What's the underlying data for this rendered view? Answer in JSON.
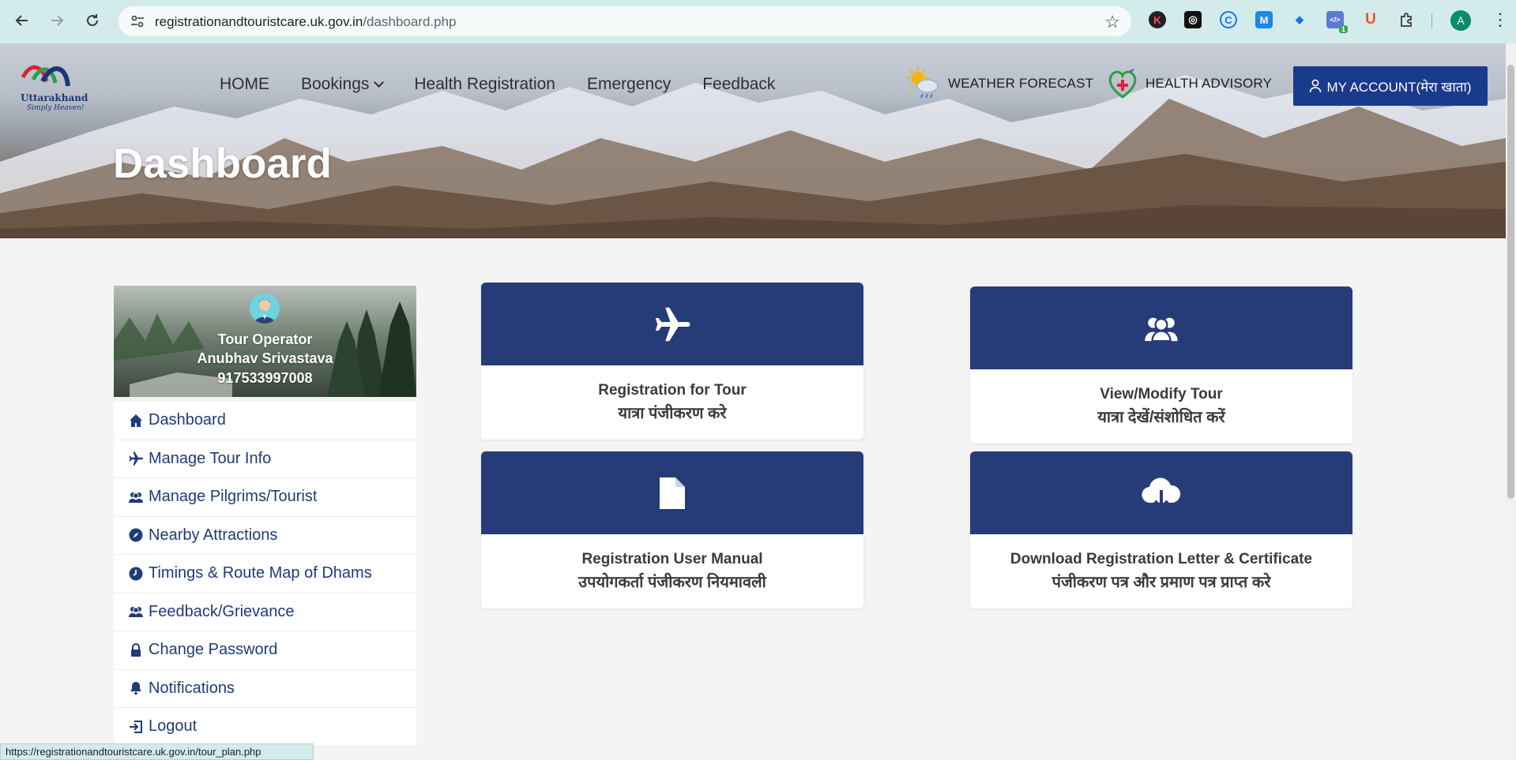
{
  "browser": {
    "url_host": "registrationandtouristcare.uk.gov.in",
    "url_path": "/dashboard.php",
    "profile_initial": "A",
    "status_url": "https://registrationandtouristcare.uk.gov.in/tour_plan.php",
    "extensions": [
      {
        "icon": "k-extension-icon",
        "label": "K",
        "color": "#d7263d"
      },
      {
        "icon": "openai-extension-icon",
        "label": "◎",
        "color": "#111111"
      },
      {
        "icon": "c-extension-icon",
        "label": "C",
        "color": "#1a73e8"
      },
      {
        "icon": "m-extension-icon",
        "label": "M",
        "color": "#1e88e5"
      },
      {
        "icon": "tag-extension-icon",
        "label": "◆",
        "color": "#1a73e8"
      },
      {
        "icon": "code-extension-icon",
        "label": "</>",
        "color": "#5b7bd5",
        "badge": "1"
      },
      {
        "icon": "u-extension-icon",
        "label": "U",
        "color": "#f0561d"
      }
    ]
  },
  "header": {
    "logo_text": "Uttarakhand",
    "logo_tagline": "Simply Heaven!",
    "nav": [
      "HOME",
      "Bookings",
      "Health Registration",
      "Emergency",
      "Feedback"
    ],
    "weather_label": "WEATHER FORECAST",
    "advisory_label": "HEALTH ADVISORY",
    "account_label": "MY ACCOUNT(मेरा खाता)"
  },
  "page_title": "Dashboard",
  "profile": {
    "role": "Tour Operator",
    "name": "Anubhav Srivastava",
    "phone": "917533997008"
  },
  "sidebar": {
    "items": [
      {
        "label": "Dashboard",
        "icon": "home-icon"
      },
      {
        "label": "Manage Tour Info",
        "icon": "plane-icon"
      },
      {
        "label": "Manage Pilgrims/Tourist",
        "icon": "users-icon"
      },
      {
        "label": "Nearby Attractions",
        "icon": "compass-icon"
      },
      {
        "label": "Timings & Route Map of Dhams",
        "icon": "clock-icon"
      },
      {
        "label": "Feedback/Grievance",
        "icon": "users-icon"
      },
      {
        "label": "Change Password",
        "icon": "lock-icon"
      },
      {
        "label": "Notifications",
        "icon": "bell-icon"
      },
      {
        "label": "Logout",
        "icon": "logout-icon"
      }
    ]
  },
  "cards": [
    {
      "en": "Registration for Tour",
      "hi": "यात्रा पंजीकरण करे",
      "icon": "plane-icon"
    },
    {
      "en": "View/Modify Tour",
      "hi": "यात्रा देखें/संशोधित करें",
      "icon": "users-icon"
    },
    {
      "en": "Registration User Manual",
      "hi": "उपयोगकर्ता पंजीकरण नियमावली",
      "icon": "document-icon"
    },
    {
      "en": "Download Registration Letter & Certificate",
      "hi": "पंजीकरण पत्र और प्रमाण पत्र प्राप्त करे",
      "icon": "cloud-download-icon"
    }
  ],
  "colors": {
    "brand_navy": "#263c78",
    "account_button": "#1a3a8c",
    "link_blue": "#1f3b7a"
  }
}
